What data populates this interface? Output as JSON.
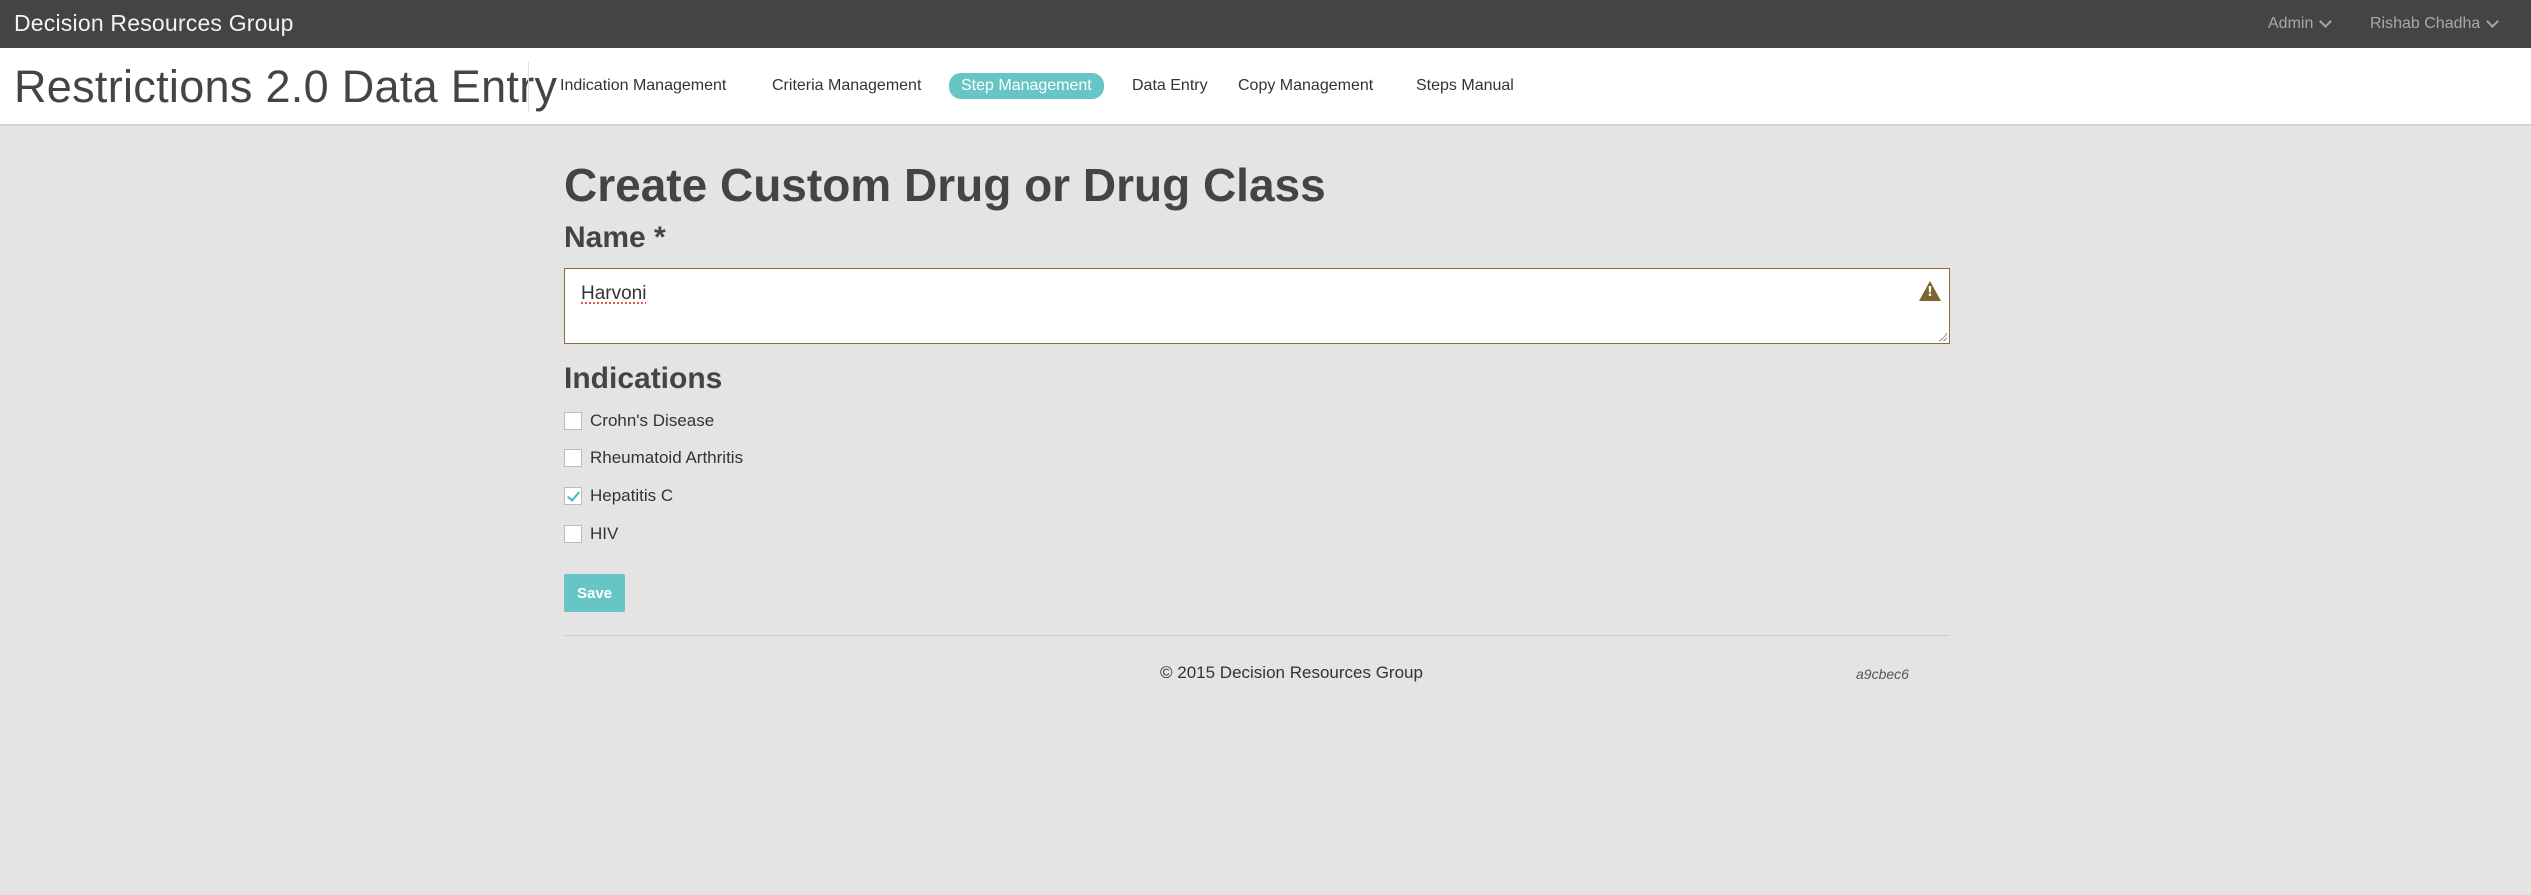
{
  "topbar": {
    "brand": "Decision Resources Group",
    "admin_menu": "Admin",
    "user_menu": "Rishab Chadha"
  },
  "navbar": {
    "app_title": "Restrictions 2.0 Data Entry",
    "items": [
      {
        "label": "Indication Management",
        "active": false
      },
      {
        "label": "Criteria Management",
        "active": false
      },
      {
        "label": "Step Management",
        "active": true
      },
      {
        "label": "Data Entry",
        "active": false
      },
      {
        "label": "Copy Management",
        "active": false
      },
      {
        "label": "Steps Manual",
        "active": false
      }
    ]
  },
  "form": {
    "title": "Create Custom Drug or Drug Class",
    "name_label": "Name *",
    "name_value": "Harvoni",
    "name_warning_icon": "warning-triangle-icon",
    "indications_label": "Indications",
    "indications": [
      {
        "label": "Crohn's Disease",
        "checked": false
      },
      {
        "label": "Rheumatoid Arthritis",
        "checked": false
      },
      {
        "label": "Hepatitis C",
        "checked": true
      },
      {
        "label": "HIV",
        "checked": false
      }
    ],
    "save_label": "Save"
  },
  "footer": {
    "copyright": "© 2015 Decision Resources Group",
    "version_hash": "a9cbec6"
  },
  "colors": {
    "topbar_bg": "#444444",
    "accent": "#68c5c6",
    "page_bg": "#e4e4e4",
    "warning": "#8a6d3b"
  }
}
